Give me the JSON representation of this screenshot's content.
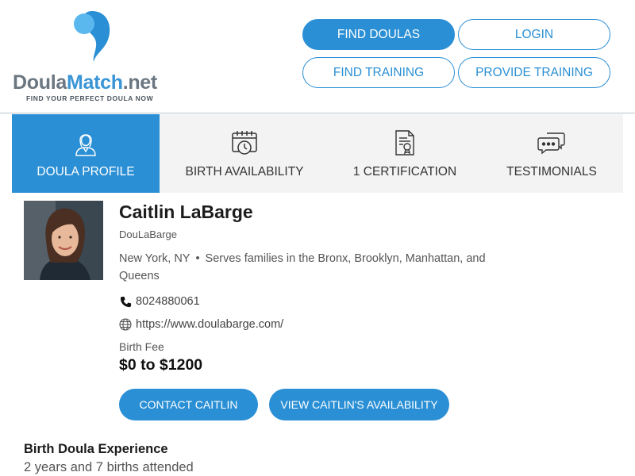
{
  "colors": {
    "accent": "#2a8fd4",
    "logo_light_blue": "#5ab8ef",
    "tab_bar_bg": "#f3f3f3",
    "text_muted": "#555555"
  },
  "logo": {
    "word1": "Doula",
    "word2": "Match",
    "word3": ".net",
    "tagline": "FIND YOUR PERFECT DOULA NOW"
  },
  "nav": {
    "find_doulas": "FIND DOULAS",
    "login": "LOGIN",
    "find_training": "FIND TRAINING",
    "provide_training": "PROVIDE TRAINING"
  },
  "tabs": [
    {
      "label": "DOULA PROFILE",
      "icon": "doula-person-icon",
      "active": true
    },
    {
      "label": "BIRTH AVAILABILITY",
      "icon": "calendar-clock-icon",
      "active": false
    },
    {
      "label": "1 CERTIFICATION",
      "icon": "certificate-document-icon",
      "active": false
    },
    {
      "label": "TESTIMONIALS",
      "icon": "chat-bubbles-icon",
      "active": false
    }
  ],
  "profile": {
    "name": "Caitlin LaBarge",
    "username": "DouLaBarge",
    "city": "New York, NY",
    "service_area": "Serves families in the Bronx, Brooklyn, Manhattan, and Queens",
    "phone": "8024880061",
    "phone_icon": "phone-icon",
    "website": "https://www.doulabarge.com/",
    "website_icon": "globe-icon",
    "fee_label": "Birth Fee",
    "fee_value": "$0 to $1200",
    "contact_button": "CONTACT CAITLIN",
    "availability_button": "VIEW CAITLIN'S AVAILABILITY"
  },
  "experience": {
    "heading": "Birth Doula Experience",
    "value": "2 years and 7 births attended"
  }
}
